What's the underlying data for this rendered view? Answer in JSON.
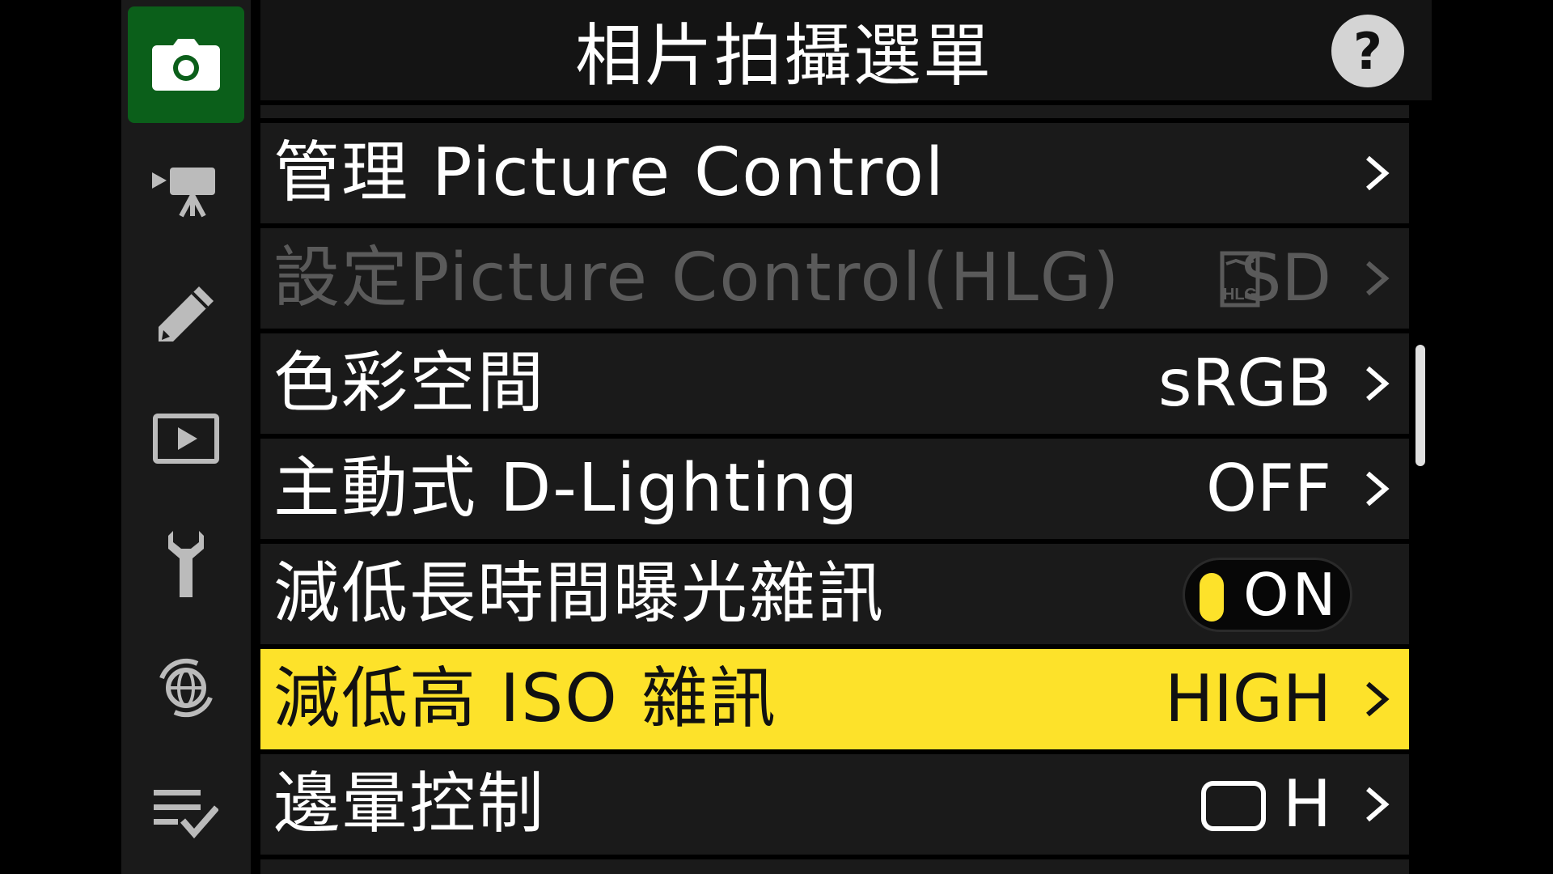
{
  "header": {
    "title": "相片拍攝選單",
    "help_label": "?"
  },
  "sidebar": {
    "items": [
      {
        "icon": "camera-icon",
        "active": true
      },
      {
        "icon": "movie-camera-icon",
        "active": false
      },
      {
        "icon": "pencil-icon",
        "active": false
      },
      {
        "icon": "playback-icon",
        "active": false
      },
      {
        "icon": "wrench-icon",
        "active": false
      },
      {
        "icon": "network-icon",
        "active": false
      },
      {
        "icon": "my-menu-icon",
        "active": false
      }
    ]
  },
  "menu": {
    "items": [
      {
        "label": "管理 Picture Control",
        "value": "",
        "chevron": ">"
      },
      {
        "label": "設定Picture Control(HLG)",
        "value": "SD",
        "value_icon_text": "HLG",
        "disabled": true,
        "chevron": ">"
      },
      {
        "label": "色彩空間",
        "value": "sRGB",
        "chevron": ">"
      },
      {
        "label": "主動式 D-Lighting",
        "value": "OFF",
        "chevron": ">"
      },
      {
        "label": "減低長時間曝光雜訊",
        "toggle": "ON"
      },
      {
        "label": "減低高 ISO 雜訊",
        "value": "HIGH",
        "selected": true,
        "chevron": ">"
      },
      {
        "label": "邊暈控制",
        "value": "H",
        "chevron": ">"
      }
    ]
  },
  "colors": {
    "selected_bg": "#fde22a",
    "active_tab_bg": "#0b5f1a",
    "row_bg": "#1a1a1a",
    "disabled_text": "#5a5a5a"
  }
}
